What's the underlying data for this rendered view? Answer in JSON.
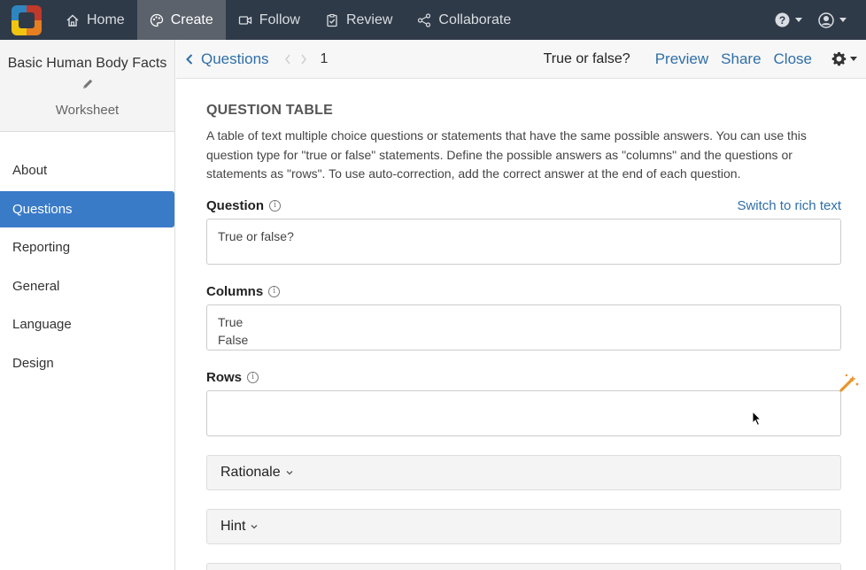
{
  "nav": {
    "items": [
      {
        "label": "Home",
        "icon": "home-icon"
      },
      {
        "label": "Create",
        "icon": "palette-icon",
        "active": true
      },
      {
        "label": "Follow",
        "icon": "video-icon"
      },
      {
        "label": "Review",
        "icon": "clipboard-icon"
      },
      {
        "label": "Collaborate",
        "icon": "share-icon"
      }
    ]
  },
  "sidebar": {
    "title": "Basic Human Body Facts",
    "subtitle": "Worksheet",
    "items": [
      "About",
      "Questions",
      "Reporting",
      "General",
      "Language",
      "Design"
    ],
    "active": "Questions"
  },
  "header": {
    "back_label": "Questions",
    "question_number": "1",
    "question_title": "True or false?",
    "preview": "Preview",
    "share": "Share",
    "close": "Close"
  },
  "content": {
    "type_title": "QUESTION TABLE",
    "description": "A table of text multiple choice questions or statements that have the same possible answers. You can use this question type for \"true or false\" statements. Define the possible answers as \"columns\" and the questions or statements as \"rows\". To use auto-correction, add the correct answer at the end of each question.",
    "question_label": "Question",
    "switch_rich_text": "Switch to rich text",
    "question_value": "True or false?",
    "columns_label": "Columns",
    "columns_values": [
      "True",
      "False"
    ],
    "rows_label": "Rows",
    "rows_value": "",
    "rationale_label": "Rationale",
    "hint_label": "Hint"
  },
  "colors": {
    "topnav": "#2f3a48",
    "accent": "#3a7bc8",
    "link": "#2f6fa8",
    "wand": "#e8952b"
  }
}
